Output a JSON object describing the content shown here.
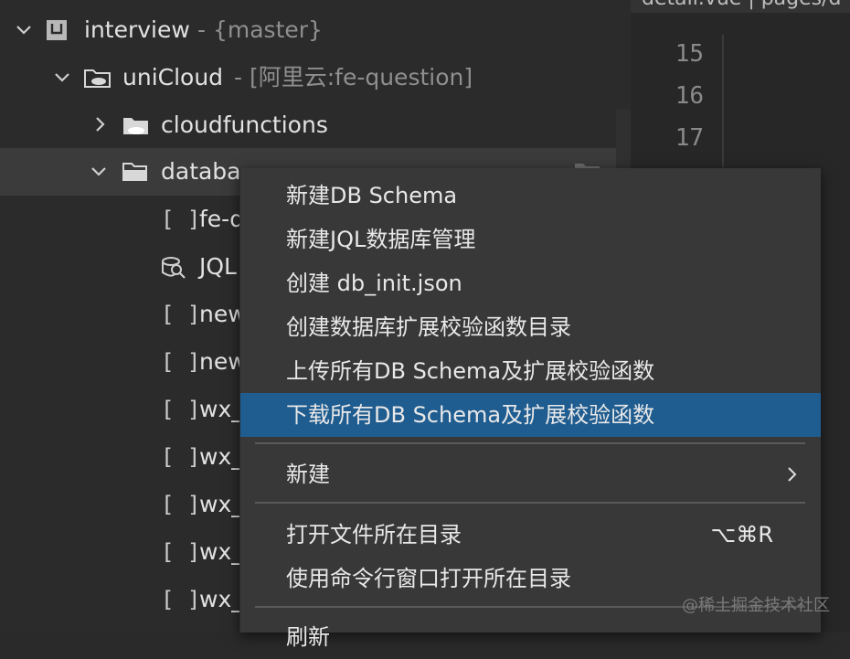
{
  "tree": {
    "project_name": "interview",
    "project_branch": "- {master}",
    "cloud_name": "uniCloud",
    "cloud_meta": "- [阿里云:fe-question]",
    "cloudfunctions": "cloudfunctions",
    "database": "databa",
    "files": [
      {
        "icon": "[ ]",
        "label": "fe-q"
      },
      {
        "icon": "jql",
        "label": "JQL"
      },
      {
        "icon": "[ ]",
        "label": "new"
      },
      {
        "icon": "[ ]",
        "label": "new"
      },
      {
        "icon": "[ ]",
        "label": "wx_"
      },
      {
        "icon": "[ ]",
        "label": "wx_"
      },
      {
        "icon": "[ ]",
        "label": "wx_"
      },
      {
        "icon": "[ ]",
        "label": "wx_"
      },
      {
        "icon": "[ ]",
        "label": "wx_"
      }
    ]
  },
  "editor": {
    "tab_label": "detail.vue | pages/d",
    "line_numbers": [
      "15",
      "16",
      "17"
    ]
  },
  "context_menu": {
    "items": [
      {
        "label": "新建DB Schema"
      },
      {
        "label": "新建JQL数据库管理"
      },
      {
        "label": "创建 db_init.json"
      },
      {
        "label": "创建数据库扩展校验函数目录"
      },
      {
        "label": "上传所有DB Schema及扩展校验函数"
      },
      {
        "label": "下载所有DB Schema及扩展校验函数"
      }
    ],
    "new_label": "新建",
    "open_dir_label": "打开文件所在目录",
    "open_dir_shortcut": "⌥⌘R",
    "open_cmd_label": "使用命令行窗口打开所在目录",
    "refresh_label": "刷新"
  },
  "watermark": "@稀土掘金技术社区",
  "colors": {
    "highlight": "#1f5c8f",
    "menu_bg": "#383838",
    "sidebar_bg": "#2b2b2b"
  }
}
